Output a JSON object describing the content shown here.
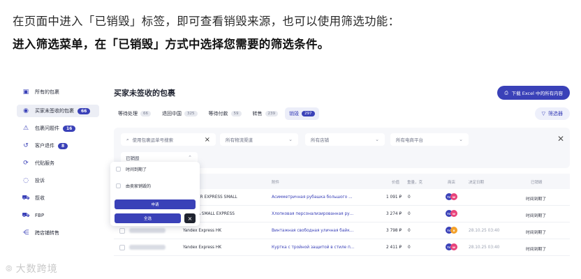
{
  "intro": {
    "line1": "在页面中进入「已销毁」标签，即可查看销毁来源，也可以使用筛选功能：",
    "line2": "进入筛选菜单，在「已销毁」方式中选择您需要的筛选条件。"
  },
  "sidebar": {
    "items": [
      {
        "label": "所有的包裹",
        "icon": "package-icon"
      },
      {
        "label": "买家未签收的包裹",
        "icon": "eye-icon",
        "badge": "66"
      },
      {
        "label": "包裹问题件",
        "icon": "warning-icon",
        "badge": "16"
      },
      {
        "label": "客户退件",
        "icon": "return-icon",
        "badge": "8"
      },
      {
        "label": "代贴服务",
        "icon": "refresh-icon"
      },
      {
        "label": "投诉",
        "icon": "chat-icon"
      },
      {
        "label": "揽收",
        "icon": "truck-icon"
      },
      {
        "label": "FBP",
        "icon": "truck-icon"
      },
      {
        "label": "跨店铺转售",
        "icon": "share-icon"
      }
    ]
  },
  "main": {
    "title": "买家未签收的包裹",
    "download_label": "下载 Excel 中的所有内容",
    "filter_label": "筛选器",
    "tabs": [
      {
        "label": "等待处理",
        "count": "66"
      },
      {
        "label": "退回中国",
        "count": "325"
      },
      {
        "label": "等待付款",
        "count": "59"
      },
      {
        "label": "转售",
        "count": "239"
      },
      {
        "label": "销毁",
        "count": "297"
      }
    ]
  },
  "filters": {
    "search_placeholder": "使用包裹运单号搜索",
    "logistics": "所有物流渠道",
    "stores": "所有店铺",
    "platforms": "所有电商平台",
    "destroyed": "已销毁"
  },
  "table": {
    "headers": {
      "goods": "附件",
      "price": "价值",
      "weight": "重量，克",
      "store": "商店",
      "date": "决定日期",
      "destroyed": "已销毁"
    },
    "rows": [
      {
        "shipping": "ER EXPRESS SMALL",
        "goods": "Асимметричная рубашка большого ...",
        "price": "1 091 ₽",
        "weight": "0",
        "date": "",
        "status": "时间到期了"
      },
      {
        "shipping": "A SMALL EXPRESS",
        "goods": "Хлопковая персонализированная ру...",
        "price": "3 274 ₽",
        "weight": "0",
        "date": "",
        "status": "时间到期了"
      },
      {
        "shipping": "Yandex Express HK",
        "goods": "Винтажная свободная уличная байк...",
        "price": "3 798 ₽",
        "weight": "0",
        "date": "28.10.25 03:40",
        "status": "时间到期了"
      },
      {
        "shipping": "Yandex Express HK",
        "goods": "Куртка с тройной защитой в стиле п...",
        "price": "2 411 ₽",
        "weight": "0",
        "date": "28.10.25 03:40",
        "status": "时间到期了"
      }
    ]
  },
  "dropdown": {
    "option1": "时间到期了",
    "option2": "由卖家销毁的",
    "apply": "申请",
    "reset": "全选"
  },
  "watermark": {
    "text": "大数跨境"
  },
  "colors": {
    "accent": "#3a41b8",
    "pink": "#e8437a",
    "orange": "#f4a12a"
  }
}
